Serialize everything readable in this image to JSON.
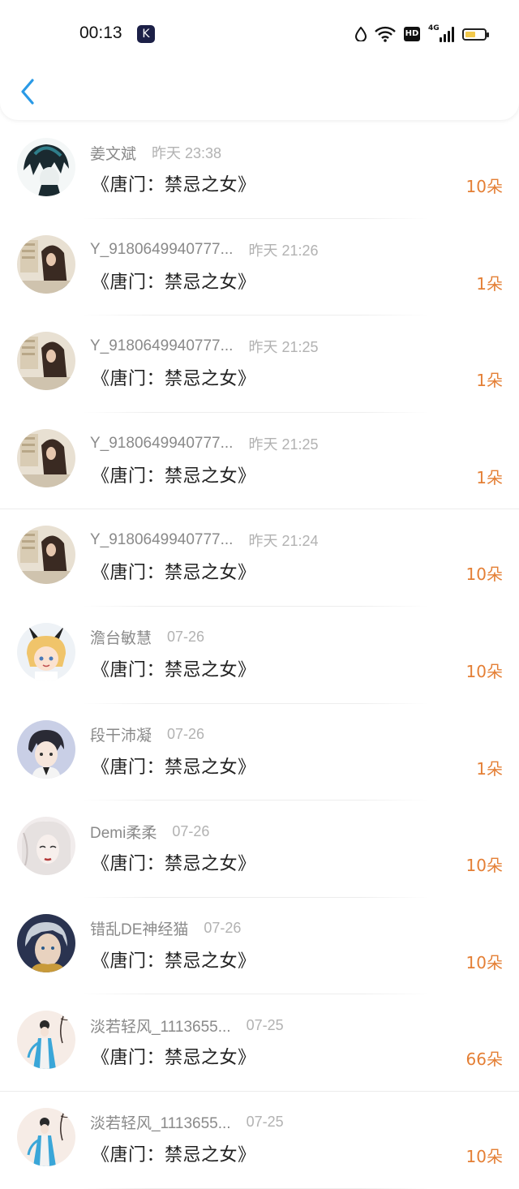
{
  "status_bar": {
    "time": "00:13",
    "app_badge": "K",
    "network_label": "HD",
    "cellular_label": "4G",
    "battery_level": 0.55,
    "battery_color": "#f2c94c"
  },
  "nav": {
    "back_icon": "chevron-left-icon",
    "accent": "#2a9ae6"
  },
  "colors": {
    "amount": "#e47f35",
    "name": "#8a8a8a",
    "date": "#b2b2b2"
  },
  "records": [
    {
      "name": "姜文斌",
      "date": "昨天 23:38",
      "title": "《唐门：禁忌之女》",
      "amount": "10朵",
      "avatar": "dark-hair-boy"
    },
    {
      "name": "Y_9180649940777...",
      "date": "昨天 21:26",
      "title": "《唐门：禁忌之女》",
      "amount": "1朵",
      "avatar": "girl-long-hair"
    },
    {
      "name": "Y_9180649940777...",
      "date": "昨天 21:25",
      "title": "《唐门：禁忌之女》",
      "amount": "1朵",
      "avatar": "girl-long-hair"
    },
    {
      "name": "Y_9180649940777...",
      "date": "昨天 21:25",
      "title": "《唐门：禁忌之女》",
      "amount": "1朵",
      "avatar": "girl-long-hair"
    },
    {
      "name": "Y_9180649940777...",
      "date": "昨天 21:24",
      "title": "《唐门：禁忌之女》",
      "amount": "10朵",
      "avatar": "girl-long-hair"
    },
    {
      "name": "澹台敏慧",
      "date": "07-26",
      "title": "《唐门：禁忌之女》",
      "amount": "10朵",
      "avatar": "anime-blonde-bunny"
    },
    {
      "name": "段干沛凝",
      "date": "07-26",
      "title": "《唐门：禁忌之女》",
      "amount": "1朵",
      "avatar": "anime-boy"
    },
    {
      "name": "Demi柔柔",
      "date": "07-26",
      "title": "《唐门：禁忌之女》",
      "amount": "10朵",
      "avatar": "pale-white-hair"
    },
    {
      "name": "错乱DE神经猫",
      "date": "07-26",
      "title": "《唐门：禁忌之女》",
      "amount": "10朵",
      "avatar": "cgi-elf"
    },
    {
      "name": "淡若轻风_1113655...",
      "date": "07-25",
      "title": "《唐门：禁忌之女》",
      "amount": "66朵",
      "avatar": "ink-painting-lady"
    },
    {
      "name": "淡若轻风_1113655...",
      "date": "07-25",
      "title": "《唐门：禁忌之女》",
      "amount": "10朵",
      "avatar": "ink-painting-lady"
    }
  ]
}
